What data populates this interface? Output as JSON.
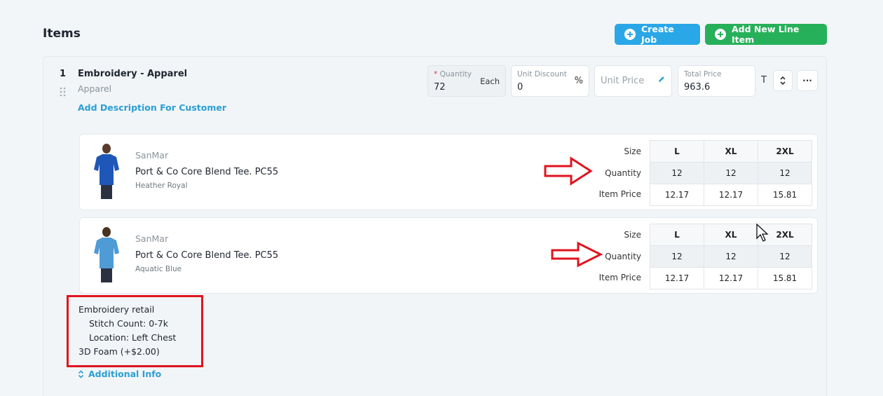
{
  "header": {
    "title": "Items"
  },
  "actions": {
    "create_job": "Create Job",
    "add_line_item": "Add New Line Item"
  },
  "line_item": {
    "number": "1",
    "title": "Embroidery - Apparel",
    "category": "Apparel",
    "add_description": "Add Description For Customer",
    "quantity": {
      "label": "Quantity",
      "required_mark": "*",
      "value": "72",
      "unit": "Each"
    },
    "unit_discount": {
      "label": "Unit Discount",
      "value": "0",
      "suffix": "%"
    },
    "unit_price": {
      "placeholder": "Unit Price"
    },
    "total_price": {
      "label": "Total Price",
      "value": "963.6"
    },
    "tax_flag": "T",
    "more": "···"
  },
  "row_labels": {
    "size": "Size",
    "quantity": "Quantity",
    "item_price": "Item Price"
  },
  "products": [
    {
      "vendor": "SanMar",
      "name": "Port & Co Core Blend Tee. PC55",
      "color": "Heather Royal",
      "shirt_color": "#1f57b8",
      "sizes": [
        "L",
        "XL",
        "2XL"
      ],
      "quantities": [
        "12",
        "12",
        "12"
      ],
      "prices": [
        "12.17",
        "12.17",
        "15.81"
      ]
    },
    {
      "vendor": "SanMar",
      "name": "Port & Co Core Blend Tee. PC55",
      "color": "Aquatic Blue",
      "shirt_color": "#4f9bd6",
      "sizes": [
        "L",
        "XL",
        "2XL"
      ],
      "quantities": [
        "12",
        "12",
        "12"
      ],
      "prices": [
        "12.17",
        "12.17",
        "15.81"
      ]
    }
  ],
  "decoration": {
    "line1": "Embroidery retail",
    "line2": "Stitch Count: 0-7k",
    "line3": "Location: Left Chest",
    "line4": "3D Foam (+$2.00)"
  },
  "additional_info": "Additional Info",
  "colors": {
    "accent_blue": "#2aa7e6",
    "accent_green": "#27b05a",
    "annotation_red": "#e0141e"
  }
}
